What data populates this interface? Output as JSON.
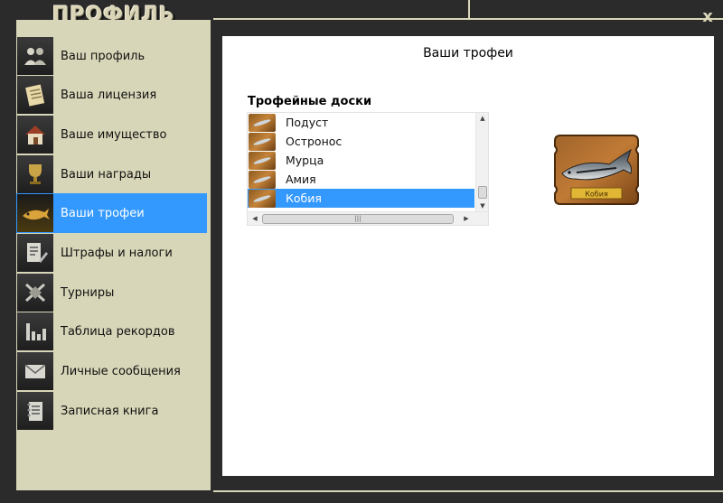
{
  "window": {
    "title": "ПРОФИЛЬ",
    "close_label": "x"
  },
  "sidebar": {
    "items": [
      {
        "label": "Ваш профиль",
        "icon": "users-icon"
      },
      {
        "label": "Ваша лицензия",
        "icon": "license-icon"
      },
      {
        "label": "Ваше имущество",
        "icon": "house-icon"
      },
      {
        "label": "Ваши награды",
        "icon": "cup-icon"
      },
      {
        "label": "Ваши трофеи",
        "icon": "fish-trophy-icon",
        "active": true
      },
      {
        "label": "Штрафы и налоги",
        "icon": "document-edit-icon"
      },
      {
        "label": "Турниры",
        "icon": "tournament-icon"
      },
      {
        "label": "Таблица рекордов",
        "icon": "bar-chart-icon"
      },
      {
        "label": "Личные сообщения",
        "icon": "envelope-icon"
      },
      {
        "label": "Записная книга",
        "icon": "notebook-icon"
      }
    ]
  },
  "main": {
    "title": "Ваши трофеи",
    "boards_label": "Трофейные доски",
    "boards": [
      {
        "label": "Подуст"
      },
      {
        "label": "Остронос"
      },
      {
        "label": "Мурца"
      },
      {
        "label": "Амия"
      },
      {
        "label": "Кобия",
        "selected": true
      }
    ],
    "preview": {
      "plaque_label": "Кобия"
    }
  },
  "colors": {
    "frame": "#2b2b2b",
    "panel": "#d8d6b8",
    "accent": "#3399ff"
  }
}
